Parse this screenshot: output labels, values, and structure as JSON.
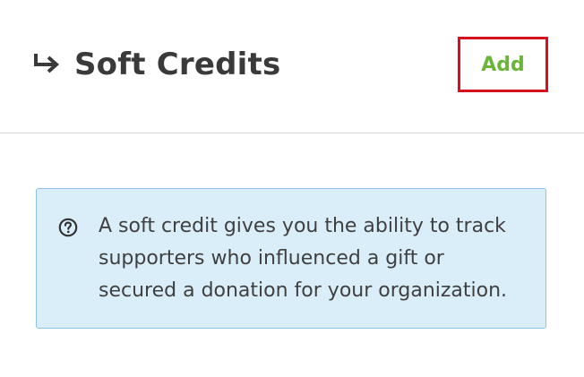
{
  "header": {
    "title": "Soft Credits",
    "add_label": "Add"
  },
  "info": {
    "line1": "A soft credit gives you the ability to track",
    "line2": "supporters who influenced a gift or",
    "line3": "secured a donation for your organization."
  },
  "colors": {
    "title": "#3a3a3a",
    "add_text": "#6ab53a",
    "highlight_border": "#d7101f",
    "info_bg": "#d9eef9",
    "info_border": "#8fc2e0"
  },
  "icons": {
    "title_icon": "subdirectory-arrow-icon",
    "info_icon": "question-circle-icon"
  }
}
